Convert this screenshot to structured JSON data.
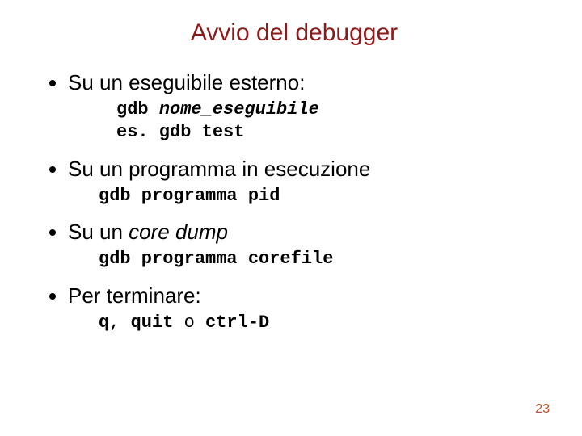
{
  "colors": {
    "title": "#8b1a1a",
    "text": "#000000",
    "page": "#c05020"
  },
  "title": "Avvio del debugger",
  "b1": {
    "text": "Su un eseguibile esterno:",
    "code_a": "gdb ",
    "code_b": "nome_eseguibile",
    "code_c": "es. gdb test"
  },
  "b2": {
    "text": "Su un programma in esecuzione",
    "code": "gdb programma pid"
  },
  "b3": {
    "text_a": "Su un ",
    "text_b": "core dump",
    "code": "gdb programma corefile"
  },
  "b4": {
    "text": "Per terminare:",
    "code_a": "q",
    "code_b": ", ",
    "code_c": "quit",
    "code_d": " o ",
    "code_e": "ctrl-D"
  },
  "page": "23"
}
